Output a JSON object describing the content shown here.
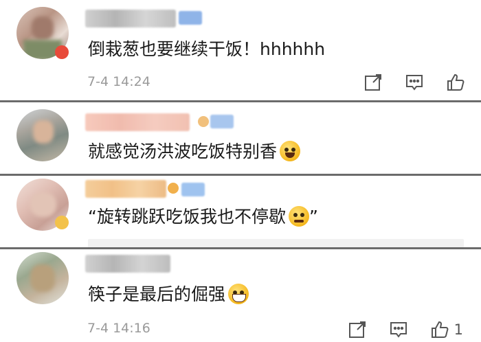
{
  "comments": [
    {
      "text": "倒栽葱也要继续干饭！hhhhhh",
      "time": "7-4 14:24",
      "avatar_color": "#c9a79b",
      "username_color": "#bcbcbc",
      "vip_color": "#8fb4e8",
      "has_emoji": false,
      "likes": ""
    },
    {
      "text": "就感觉汤洪波吃饭特别香",
      "time": "",
      "avatar_color": "#b8b3a8",
      "username_color": "#f0b3a3",
      "vip_color": "#a8c6ee",
      "has_emoji": true,
      "likes": ""
    },
    {
      "text": "“旋转跳跃吃饭我也不停歇",
      "text_suffix": "”",
      "time": "",
      "avatar_color": "#e6c6c0",
      "username_color": "#f1c07c",
      "vip_color": "#9fc3ef",
      "has_emoji": true,
      "likes": ""
    },
    {
      "text": "筷子是最后的倔强",
      "time": "7-4 14:16",
      "avatar_color": "#a7b4a6",
      "username_color": "#c0c0c0",
      "vip_color": "",
      "has_emoji": true,
      "likes": "1"
    }
  ],
  "icons": {
    "share": "share-icon",
    "comment": "comment-icon",
    "like": "thumbs-up-icon"
  }
}
